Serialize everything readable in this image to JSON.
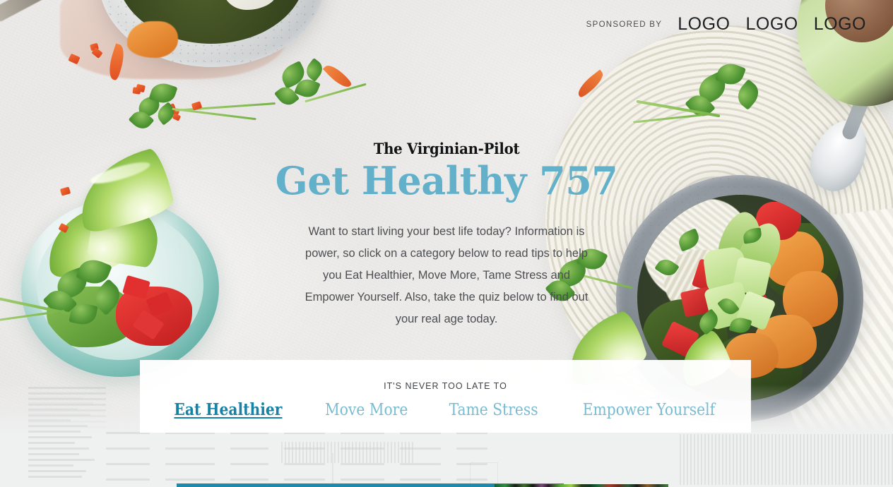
{
  "header": {
    "sponsored_label": "SPONSORED BY",
    "logos": [
      "LOGO",
      "LOGO",
      "LOGO"
    ]
  },
  "hero": {
    "masthead": "The Virginian-Pilot",
    "title": "Get Healthy 757",
    "description": "Want to start living your best life today? Information is power, so click on a category below to read tips to help you Eat Healthier, Move More, Tame Stress and Empower Yourself. Also, take the quiz below to find out your real age today.",
    "title_color": "#62b0c9"
  },
  "nav": {
    "kicker": "IT'S NEVER TOO LATE TO",
    "active_color": "#1782a5",
    "inactive_color": "#79bcd2",
    "links": [
      {
        "label": "Eat Healthier",
        "active": true
      },
      {
        "label": "Move More",
        "active": false
      },
      {
        "label": "Tame Stress",
        "active": false
      },
      {
        "label": "Empower Yourself",
        "active": false
      }
    ]
  },
  "accent_rule_color": "#1e8aab"
}
